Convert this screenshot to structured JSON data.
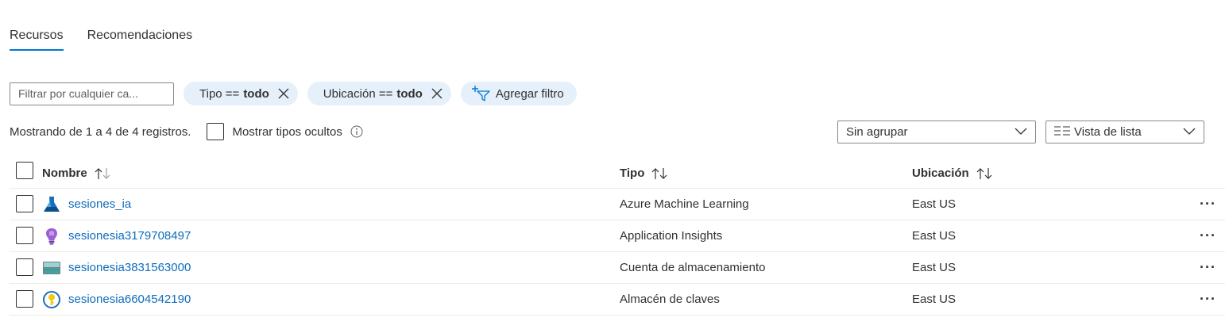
{
  "tabs": [
    {
      "label": "Recursos",
      "active": true
    },
    {
      "label": "Recomendaciones",
      "active": false
    }
  ],
  "filter": {
    "placeholder": "Filtrar por cualquier ca...",
    "pills": [
      {
        "key": "Tipo ==",
        "value": "todo"
      },
      {
        "key": "Ubicación ==",
        "value": "todo"
      }
    ],
    "add_label": "Agregar filtro"
  },
  "info": {
    "count_text": "Mostrando de 1 a 4 de 4 registros.",
    "show_hidden_label": "Mostrar tipos ocultos"
  },
  "group_select": {
    "value": "Sin agrupar"
  },
  "view_select": {
    "value": "Vista de lista"
  },
  "table": {
    "headers": {
      "name": "Nombre",
      "type": "Tipo",
      "location": "Ubicación"
    },
    "rows": [
      {
        "name": "sesiones_ia",
        "type": "Azure Machine Learning",
        "location": "East US",
        "icon": "machine-learning-icon"
      },
      {
        "name": "sesionesia3179708497",
        "type": "Application Insights",
        "location": "East US",
        "icon": "app-insights-icon"
      },
      {
        "name": "sesionesia3831563000",
        "type": "Cuenta de almacenamiento",
        "location": "East US",
        "icon": "storage-account-icon"
      },
      {
        "name": "sesionesia6604542190",
        "type": "Almacén de claves",
        "location": "East US",
        "icon": "key-vault-icon"
      }
    ]
  },
  "colors": {
    "accent": "#0078d4",
    "link": "#0f6cbd",
    "pill_bg": "#e6f0fb"
  }
}
